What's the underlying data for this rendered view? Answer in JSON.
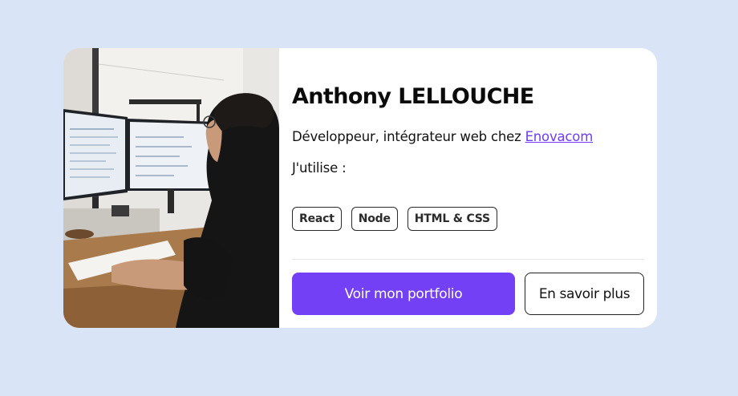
{
  "profile": {
    "photo_alt": "Anthony LELLOUCHE",
    "name": "Anthony LELLOUCHE",
    "role_prefix": "Développeur, intégrateur web chez ",
    "company": "Enovacom",
    "uses_label": "J'utilise :",
    "tags": [
      "React",
      "Node",
      "HTML & CSS"
    ]
  },
  "actions": {
    "primary_label": "Voir mon portfolio",
    "secondary_label": "En savoir plus"
  },
  "colors": {
    "page_background": "#d9e4f7",
    "card_background": "#ffffff",
    "accent": "#7340f5",
    "link": "#6d3ef0"
  }
}
